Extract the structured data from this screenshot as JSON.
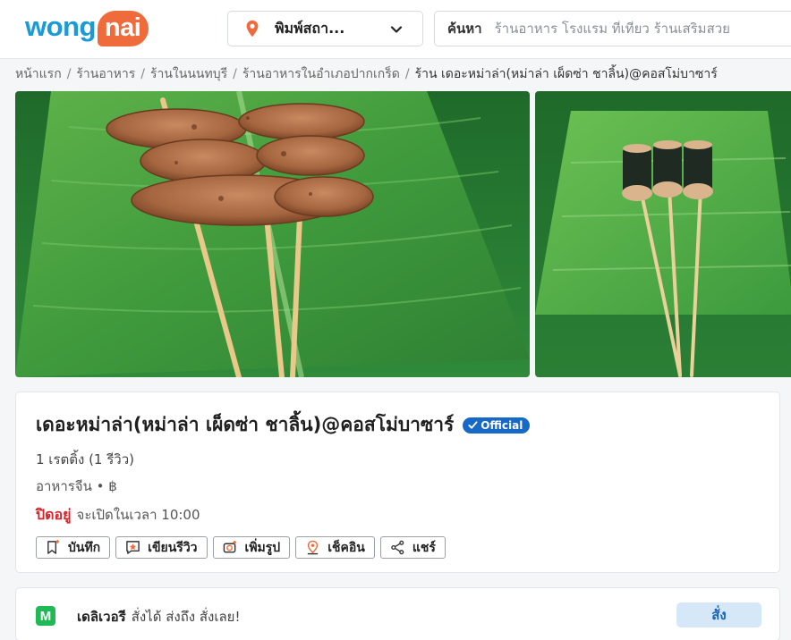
{
  "header": {
    "logo_main": "wong",
    "logo_accent": "nai",
    "location_label": "พิมพ์สถา...",
    "search_label": "ค้นหา",
    "search_placeholder": "ร้านอาหาร โรงแรม ที่เที่ยว ร้านเสริมสวย"
  },
  "breadcrumb": {
    "items": [
      "หน้าแรก",
      "ร้านอาหาร",
      "ร้านในนนทบุรี",
      "ร้านอาหารในอำเภอปากเกร็ด"
    ],
    "current": "ร้าน เดอะหม่าล่า(หม่าล่า เผ็ดซ่า ชาลิ้น)@คอสโม่บาซาร์"
  },
  "photos": {
    "photo1_icon": "grilled-skewers-photo",
    "photo2_icon": "seaweed-skewers-photo"
  },
  "restaurant": {
    "name": "เดอะหม่าล่า(หม่าล่า เผ็ดซ่า ชาลิ้น)@คอสโม่บาซาร์",
    "official_badge": "Official",
    "rating": "1 เรตติ้ง (1 รีวิว)",
    "category": "อาหารจีน • ฿",
    "status_closed": "ปิดอยู่",
    "status_opening": "จะเปิดในเวลา 10:00"
  },
  "actions": {
    "save": "บันทึก",
    "review": "เขียนรีวิว",
    "photo": "เพิ่มรูป",
    "checkin": "เช็คอิน",
    "share": "แชร์"
  },
  "delivery": {
    "brand_letter": "M",
    "title": "เดลิเวอรี",
    "text": "สั่งได้ ส่งถึง สั่งเลย!",
    "order_button": "สั่ง"
  },
  "colors": {
    "brand_blue": "#1a9ad6",
    "brand_orange": "#ef6b3b",
    "official_blue": "#1769c7",
    "closed_red": "#d8232a",
    "lineman_green": "#1fb955"
  }
}
